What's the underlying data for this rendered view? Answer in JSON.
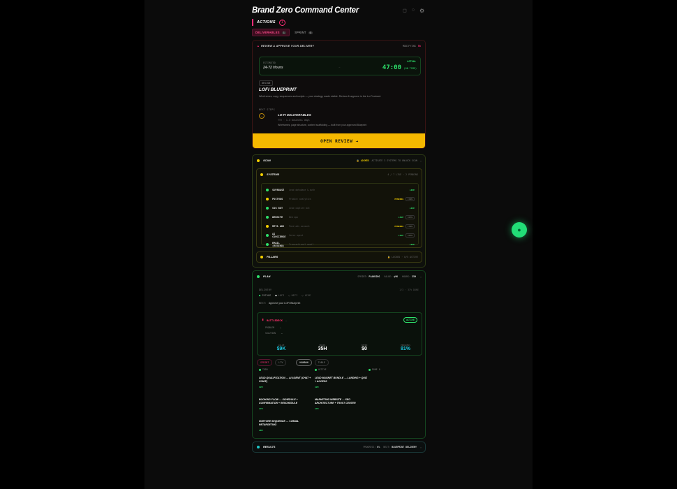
{
  "header": {
    "title": "Brand Zero Command Center"
  },
  "actions": {
    "label": "ACTIONS",
    "count": "1"
  },
  "pills": {
    "deliverables": "DELIVERABLES",
    "deliverables_count": "1",
    "sprint": "SPRINT",
    "sprint_count": "0"
  },
  "review": {
    "header": "REVIEW & APPROVE YOUR DELIVERY",
    "modified_label": "MODIFYING",
    "modified_value": "5h",
    "elapsed_label": "ESTIMATED",
    "estimate": "24-72 Hours",
    "arrow": "→",
    "actual_label": "ACTUAL",
    "clock": "47:00",
    "ontime": "ON TIME",
    "phase": "DESIGN",
    "title": "LOFI BLUEPRINT",
    "description": "Wireframes, copy, sequences and scripts — your strategy made visible. Review & approve in the Lo-Fi wizard.",
    "next_label": "NEXT STEPS",
    "next_title": "LO-FI DELIVERABLES",
    "next_meta": "TTV · 1-3 business days",
    "next_desc": "Wireframes, page structure, content scaffolding — built from your approved Blueprint",
    "button": "OPEN REVIEW →"
  },
  "scan": {
    "label": "SCAN",
    "locked": "LOCKED",
    "hint": "ACTIVATE 3 SYSTEMS TO UNLOCK SCAN",
    "systems_label": "SYSTEMS",
    "systems_right": "4 / 7 LIVE · 2 PENDING",
    "systems": [
      {
        "name": "SUPABASE",
        "desc": "Lead database & auth",
        "status": "LIVE",
        "dot": "g",
        "ctl": ""
      },
      {
        "name": "POSTHOG",
        "desc": "Product analytics",
        "status": "PENDING",
        "dot": "y",
        "ctl": "CONN"
      },
      {
        "name": "CDG BOT",
        "desc": "Lead capture bot",
        "status": "LIVE",
        "dot": "g",
        "ctl": ""
      },
      {
        "name": "WEBSITE",
        "desc": "Web app",
        "status": "LIVE",
        "dot": "g",
        "ctl": "OPEN"
      },
      {
        "name": "META ADS",
        "desc": "Paid ads account",
        "status": "PENDING",
        "dot": "y",
        "ctl": "CONN"
      },
      {
        "name": "AI CONCIERGE",
        "desc": "Voice agent",
        "status": "LIVE",
        "dot": "g",
        "ctl": "OPEN"
      },
      {
        "name": "EMAIL (RESEND)",
        "desc": "Transactional email",
        "status": "LIVE",
        "dot": "g",
        "ctl": ""
      }
    ],
    "pillars_label": "PILLARS",
    "pillars_right": "🔒 LOCKED · 0/5 ACTIVE"
  },
  "plan": {
    "label": "PLAN",
    "sprint_label": "SPRINT:",
    "sprint_value": "PLANNING",
    "value_label": "VALUE:",
    "value_value": "$9K",
    "hours_label": "HOURS:",
    "hours_value": "35H",
    "delivery_label": "DELIVERY",
    "delivery_right": "1/3 · 33% DONE",
    "steps": [
      "INTAKE",
      "LOFI",
      "HIFI",
      "LIVE"
    ],
    "next_prefix": "NEXT:",
    "next_text": "Approve your LOFI Blueprint",
    "battle_label": "BATTLEDECK",
    "battle_dash": "—",
    "battle_status": "ACTIVE",
    "problem_label": "PROBLEM",
    "problem_value": "—",
    "solution_label": "SOLUTION",
    "solution_value": "—",
    "stats": [
      {
        "k": "VALUE",
        "v": "$9K",
        "cyan": true
      },
      {
        "k": "HOURS",
        "v": "35H",
        "cyan": false
      },
      {
        "k": "SPEND",
        "v": "$0",
        "cyan": false
      },
      {
        "k": "PROGRESS",
        "v": "81%",
        "cyan": true
      }
    ],
    "tabs": {
      "sprint": "SPRINT",
      "ltv": "LTV",
      "kanban": "KANBAN",
      "table": "TABLE"
    },
    "columns": [
      {
        "h": "TODO",
        "count": "3",
        "cards": [
          {
            "t": "LEAD QUALIFICATION — AI AGENT (CHAT + VOICE)",
            "s": "12H"
          },
          {
            "t": "BOOKING FLOW — SCHEDULE + CONFIRMATION + RESCHEDULE",
            "s": "17H"
          },
          {
            "t": "NURTURE SEQUENCE — 7-EMAIL RETARGETING",
            "s": "20H"
          }
        ]
      },
      {
        "h": "ACTIVE",
        "count": "2",
        "cards": [
          {
            "t": "LEAD MAGNET BUNDLE — LANDING + QUIZ + ACCESS",
            "s": "12H"
          },
          {
            "t": "MARKETING WEBSITE — SEO ARCHITECTURE + TRUST CENTER",
            "s": "17H"
          }
        ]
      },
      {
        "h": "DONE",
        "count": "0",
        "cards": []
      }
    ]
  },
  "results": {
    "label": "RESULTS",
    "progress_label": "PROGRESS:",
    "progress_value": "0%",
    "next_label": "NEXT:",
    "next_value": "BLUEPRINT DELIVERY"
  }
}
